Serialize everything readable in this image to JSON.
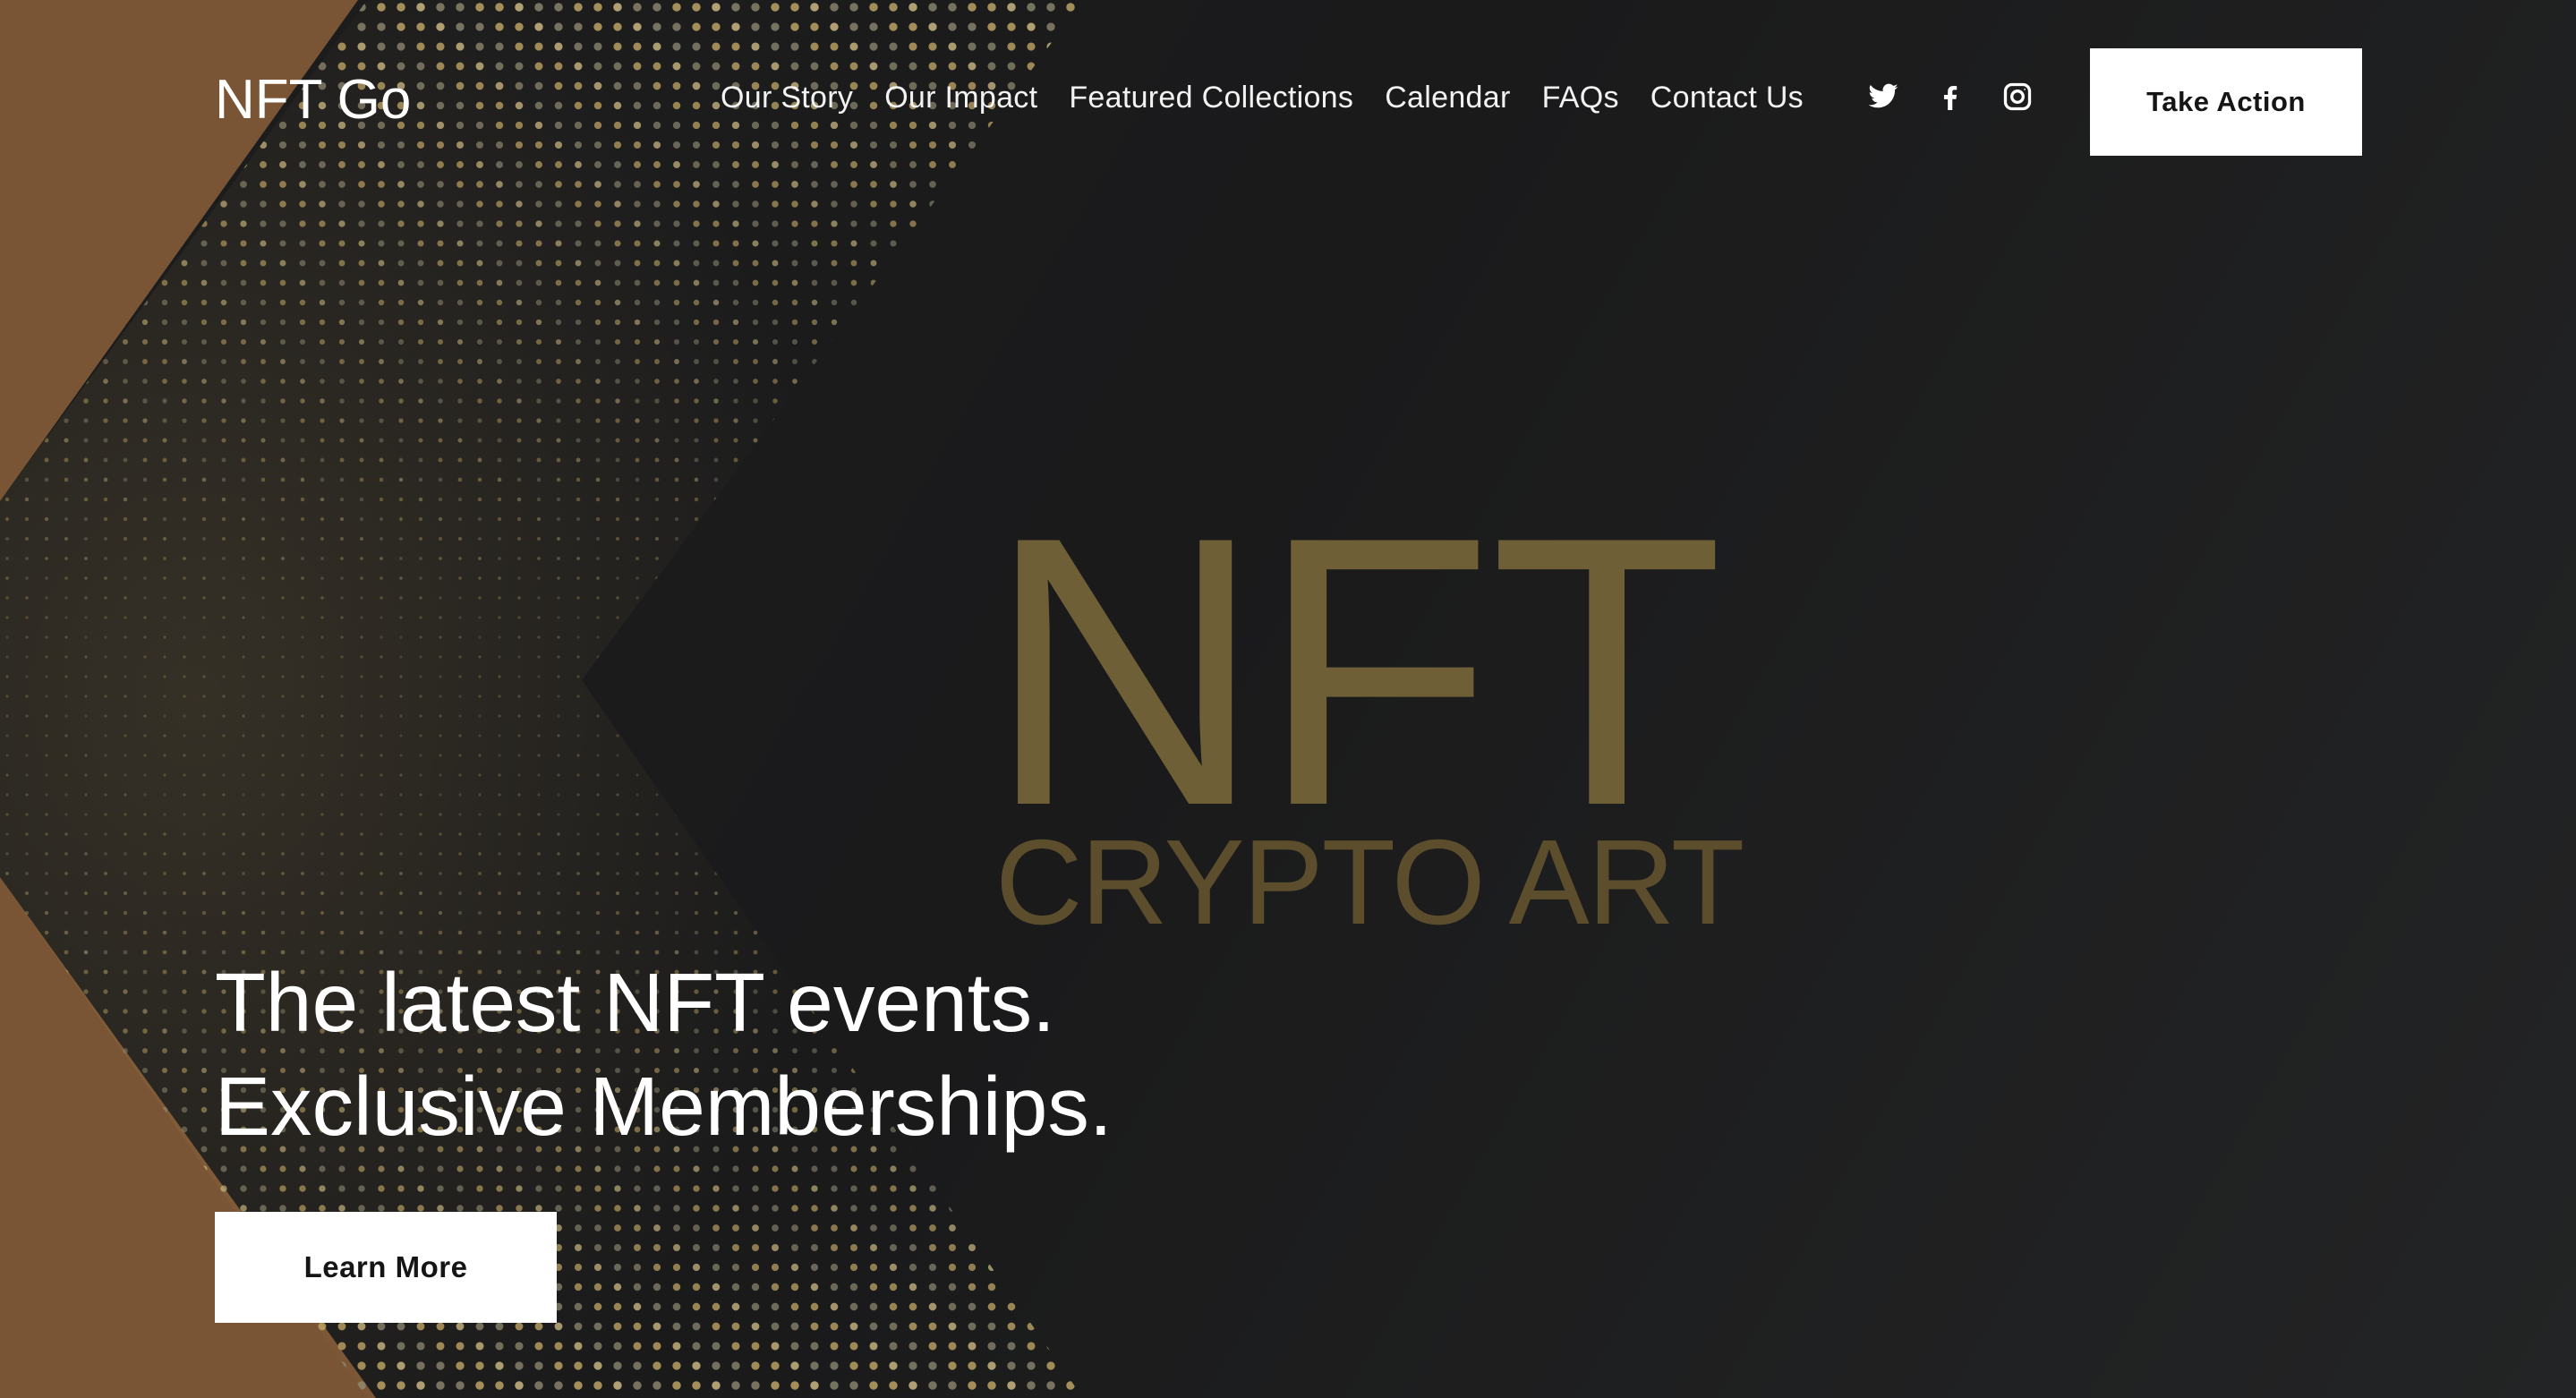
{
  "header": {
    "brand": "NFT Go",
    "nav": [
      {
        "label": "Our Story"
      },
      {
        "label": "Our Impact"
      },
      {
        "label": "Featured Collections"
      },
      {
        "label": "Calendar"
      },
      {
        "label": "FAQs"
      },
      {
        "label": "Contact Us"
      }
    ],
    "social": [
      {
        "name": "twitter-icon"
      },
      {
        "name": "facebook-icon"
      },
      {
        "name": "instagram-icon"
      }
    ],
    "cta_label": "Take Action"
  },
  "artwork": {
    "title": "NFT",
    "subtitle": "CRYPTO ART"
  },
  "hero": {
    "line1": "The latest NFT events.",
    "line2": "Exclusive Memberships.",
    "button_label": "Learn More"
  },
  "colors": {
    "background": "#1c1c1d",
    "accent_brown": "#7a5535",
    "gold_text": "#6e5f37",
    "button_bg": "#ffffff",
    "button_text": "#151515"
  }
}
